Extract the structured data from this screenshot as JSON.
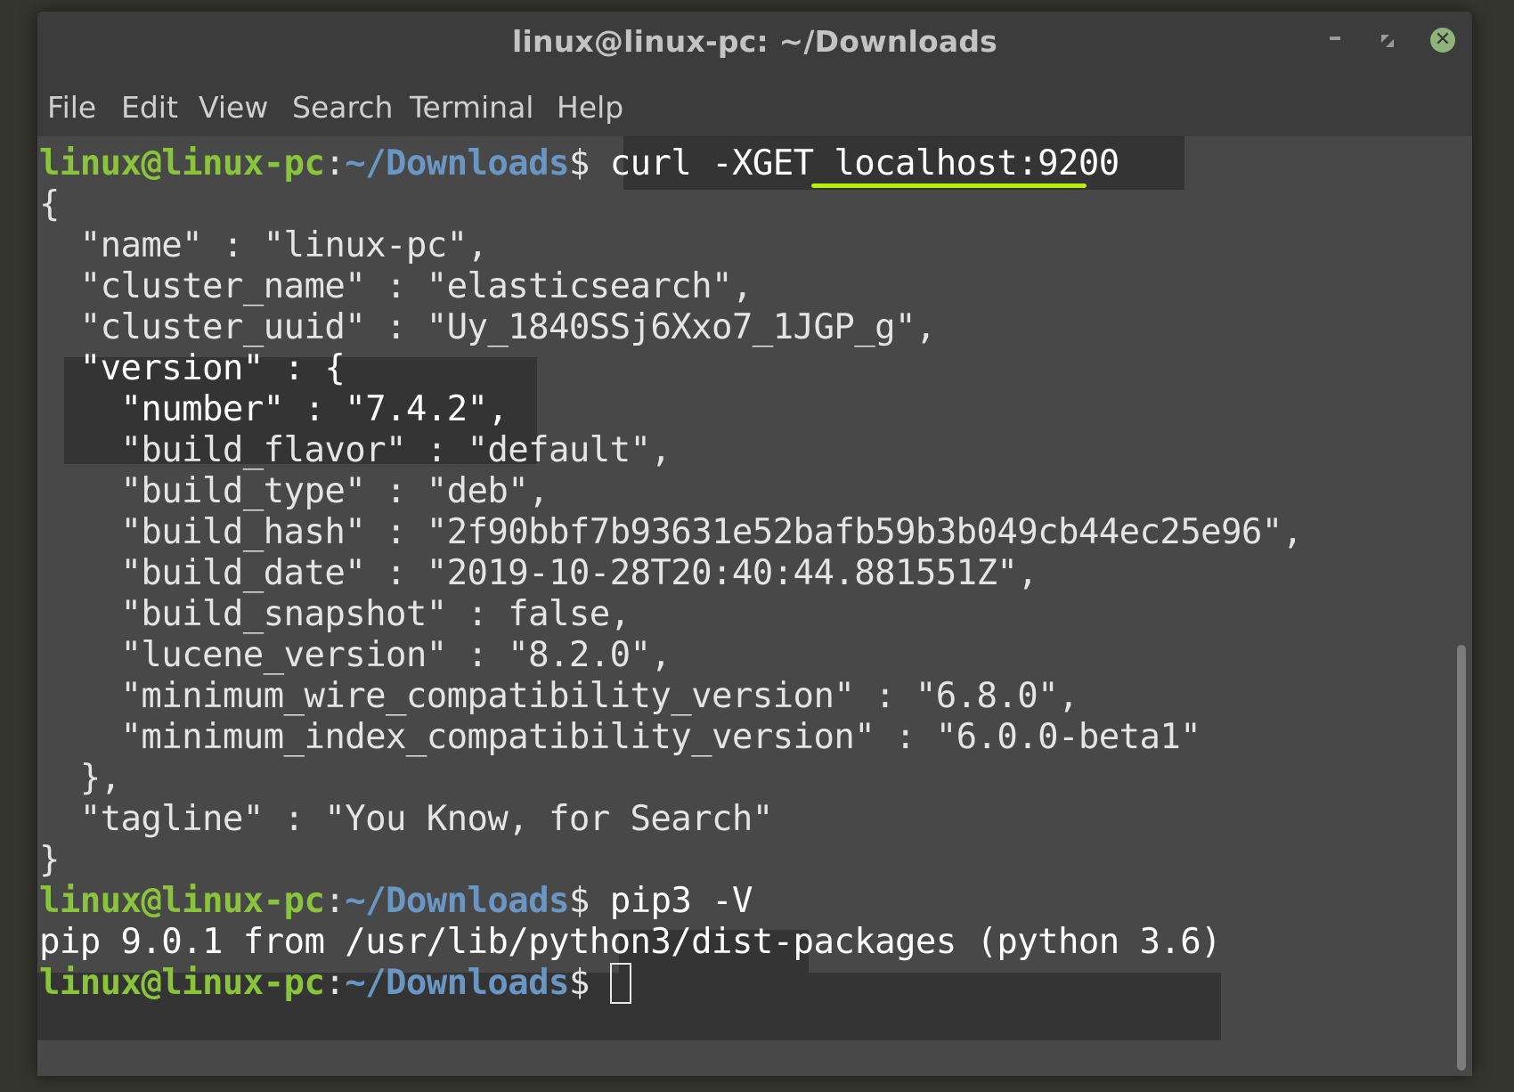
{
  "window": {
    "title": "linux@linux-pc: ~/Downloads",
    "controls": {
      "minimize": "minimize",
      "maximize": "maximize",
      "close": "✕"
    }
  },
  "menu": [
    "File",
    "Edit",
    "View",
    "Search",
    "Terminal",
    "Help"
  ],
  "prompt": {
    "user_host": "linux@linux-pc",
    "colon": ":",
    "path": "~/Downloads",
    "symbol": "$"
  },
  "commands": {
    "curl": "curl -XGET localhost:9200",
    "pip": "pip3 -V"
  },
  "output": {
    "json_lines": [
      "{",
      "  \"name\" : \"linux-pc\",",
      "  \"cluster_name\" : \"elasticsearch\",",
      "  \"cluster_uuid\" : \"Uy_1840SSj6Xxo7_1JGP_g\",",
      "  \"version\" : {",
      "    \"number\" : \"7.4.2\",",
      "    \"build_flavor\" : \"default\",",
      "    \"build_type\" : \"deb\",",
      "    \"build_hash\" : \"2f90bbf7b93631e52bafb59b3b049cb44ec25e96\",",
      "    \"build_date\" : \"2019-10-28T20:40:44.881551Z\",",
      "    \"build_snapshot\" : false,",
      "    \"lucene_version\" : \"8.2.0\",",
      "    \"minimum_wire_compatibility_version\" : \"6.8.0\",",
      "    \"minimum_index_compatibility_version\" : \"6.0.0-beta1\"",
      "  },",
      "  \"tagline\" : \"You Know, for Search\"",
      "}"
    ],
    "pip_result": "pip 9.0.1 from /usr/lib/python3/dist-packages (python 3.6)"
  },
  "colors": {
    "user_host": "#8ac43a",
    "path": "#6a96c4",
    "underline": "#b8f000",
    "close_button": "#8fb47b"
  }
}
